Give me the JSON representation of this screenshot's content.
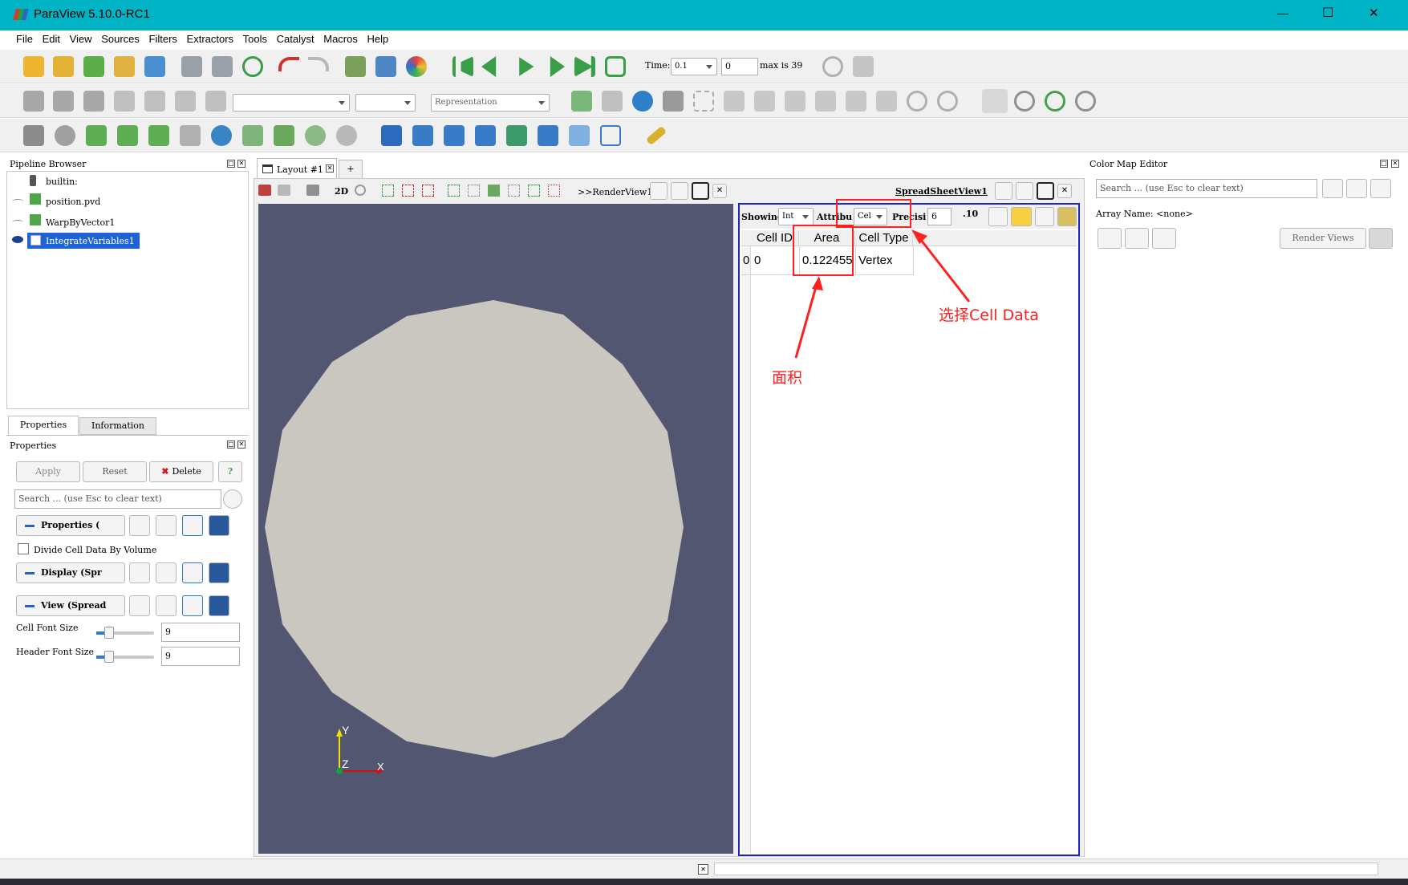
{
  "window": {
    "title": "ParaView 5.10.0-RC1",
    "minimize": "—",
    "maximize": "☐",
    "close": "✕"
  },
  "menu": [
    "File",
    "Edit",
    "View",
    "Sources",
    "Filters",
    "Extractors",
    "Tools",
    "Catalyst",
    "Macros",
    "Help"
  ],
  "time": {
    "label": "Time:",
    "value": "0.1",
    "step": "0",
    "max_label": "max is 39"
  },
  "representation": {
    "placeholder": "Representation"
  },
  "pipeline": {
    "title": "Pipeline Browser",
    "items": [
      {
        "label": "builtin:",
        "selected": false
      },
      {
        "label": "position.pvd",
        "selected": false
      },
      {
        "label": "WarpByVector1",
        "selected": false
      },
      {
        "label": "IntegrateVariables1",
        "selected": true
      }
    ]
  },
  "prop_tabs": [
    "Properties",
    "Information"
  ],
  "properties": {
    "title": "Properties",
    "apply": "Apply",
    "reset": "Reset",
    "delete": "Delete",
    "help": "?",
    "search_placeholder": "Search ... (use Esc to clear text)",
    "section_properties": "Properties (",
    "divide_label": "Divide Cell Data By Volume",
    "section_display": "Display (Spr",
    "section_view": "View (Spread",
    "cell_font_label": "Cell Font Size",
    "cell_font_value": "9",
    "header_font_label": "Header Font Size",
    "header_font_value": "9"
  },
  "layout": {
    "tab_label": "Layout #1",
    "add_tab": "+",
    "render_view_label": ">>RenderView1",
    "mode_2d": "2D"
  },
  "axes": {
    "y": "Y",
    "z": "Z",
    "x": "X"
  },
  "spreadsheet": {
    "title": "SpreadSheetView1",
    "showing_label": "Showing",
    "showing_value": "Int",
    "attribute_label": "Attribu",
    "attribute_value": "Cel",
    "precision_label": "Precisi",
    "precision_value": "6",
    "precision_fmt": ".10",
    "headers": [
      "Cell ID",
      "Area",
      "Cell Type"
    ],
    "rows": [
      {
        "index": "0",
        "cells": [
          "0",
          "0.122455",
          "Vertex"
        ]
      }
    ]
  },
  "annotations": {
    "cell_data": "选择Cell Data",
    "area": "面积"
  },
  "color_map": {
    "title": "Color Map Editor",
    "search_placeholder": "Search ... (use Esc to clear text)",
    "array_name": "Array Name: <none>",
    "render_views": "Render Views"
  },
  "colors": {
    "titlebar": "#00b4c6",
    "viewport": "#525670",
    "polygon": "#c9c7c0",
    "annotation": "#ff2020",
    "selection": "#1e63d6"
  }
}
